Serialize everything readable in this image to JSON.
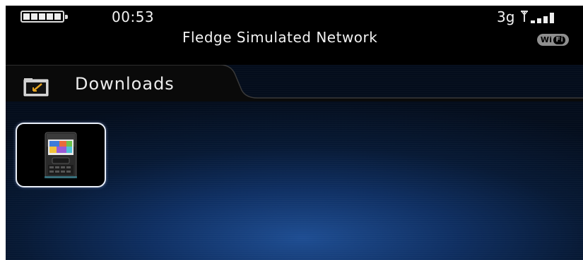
{
  "status_bar": {
    "time": "00:53",
    "network_name": "Fledge Simulated Network",
    "network_type": "3g",
    "wifi_badge": {
      "left": "Wi",
      "right": "Fi"
    },
    "battery_icon": "battery-full-icon",
    "signal_icon": "signal-bars-icon"
  },
  "tab": {
    "label": "Downloads",
    "icon": "folder-icon"
  },
  "files": [
    {
      "icon": "device-thumbnail-icon",
      "selected": true
    }
  ],
  "colors": {
    "background": "#071934",
    "accent": "#1e4d92",
    "text": "#f2f2f2",
    "selection_border": "#e8eef8"
  }
}
